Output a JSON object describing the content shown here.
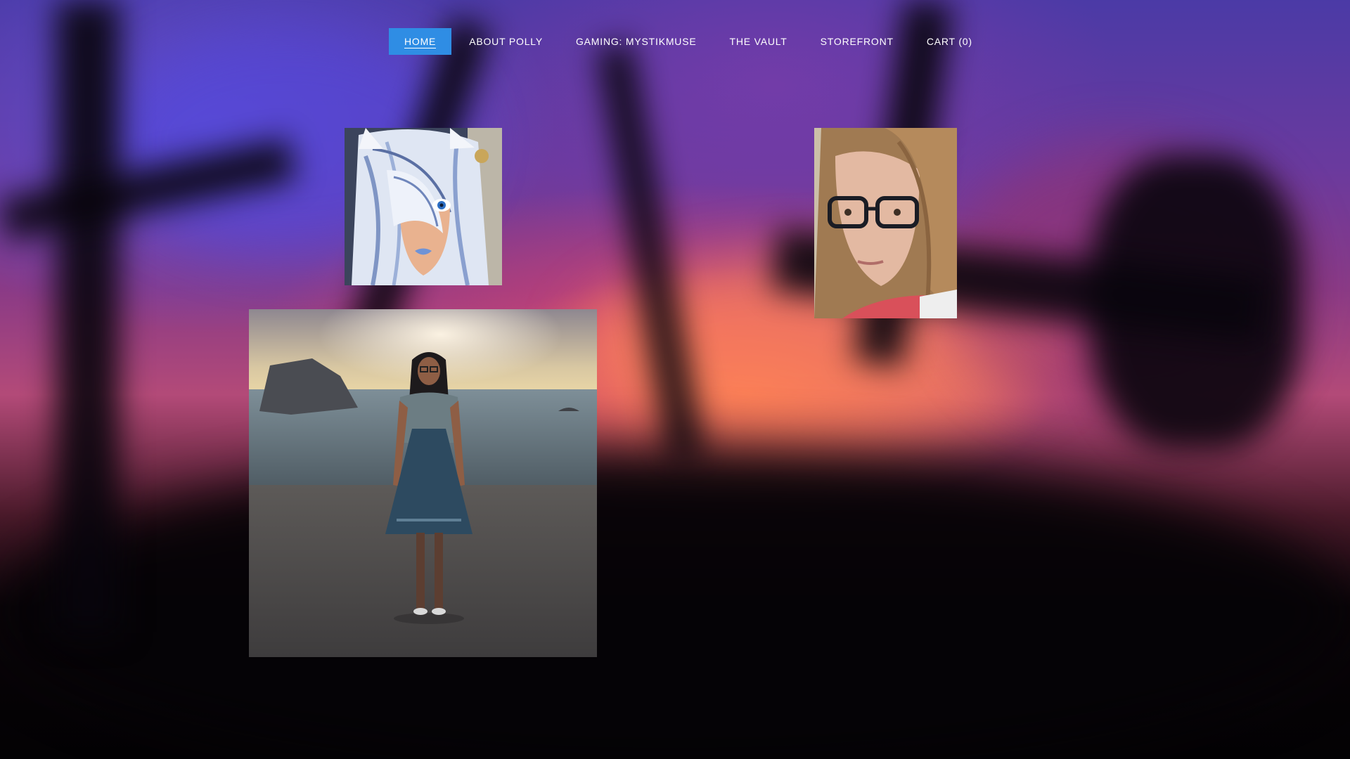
{
  "nav": {
    "items": [
      {
        "label": "HOME",
        "active": true
      },
      {
        "label": "ABOUT POLLY",
        "active": false
      },
      {
        "label": "GAMING: MYSTIKMUSE",
        "active": false
      },
      {
        "label": "THE VAULT",
        "active": false
      },
      {
        "label": "STOREFRONT",
        "active": false
      },
      {
        "label": "CART (0)",
        "active": false
      }
    ]
  },
  "colors": {
    "nav_active_bg": "#2f8de4",
    "nav_text": "#ffffff"
  },
  "images": [
    {
      "name": "anime-portrait-image",
      "subject": "stylized anime character portrait with white-blue hair"
    },
    {
      "name": "selfie-photo-image",
      "subject": "selfie portrait of a woman with glasses"
    },
    {
      "name": "beach-sim-character-image",
      "subject": "game character in a dress standing on a beach at sunset"
    }
  ]
}
